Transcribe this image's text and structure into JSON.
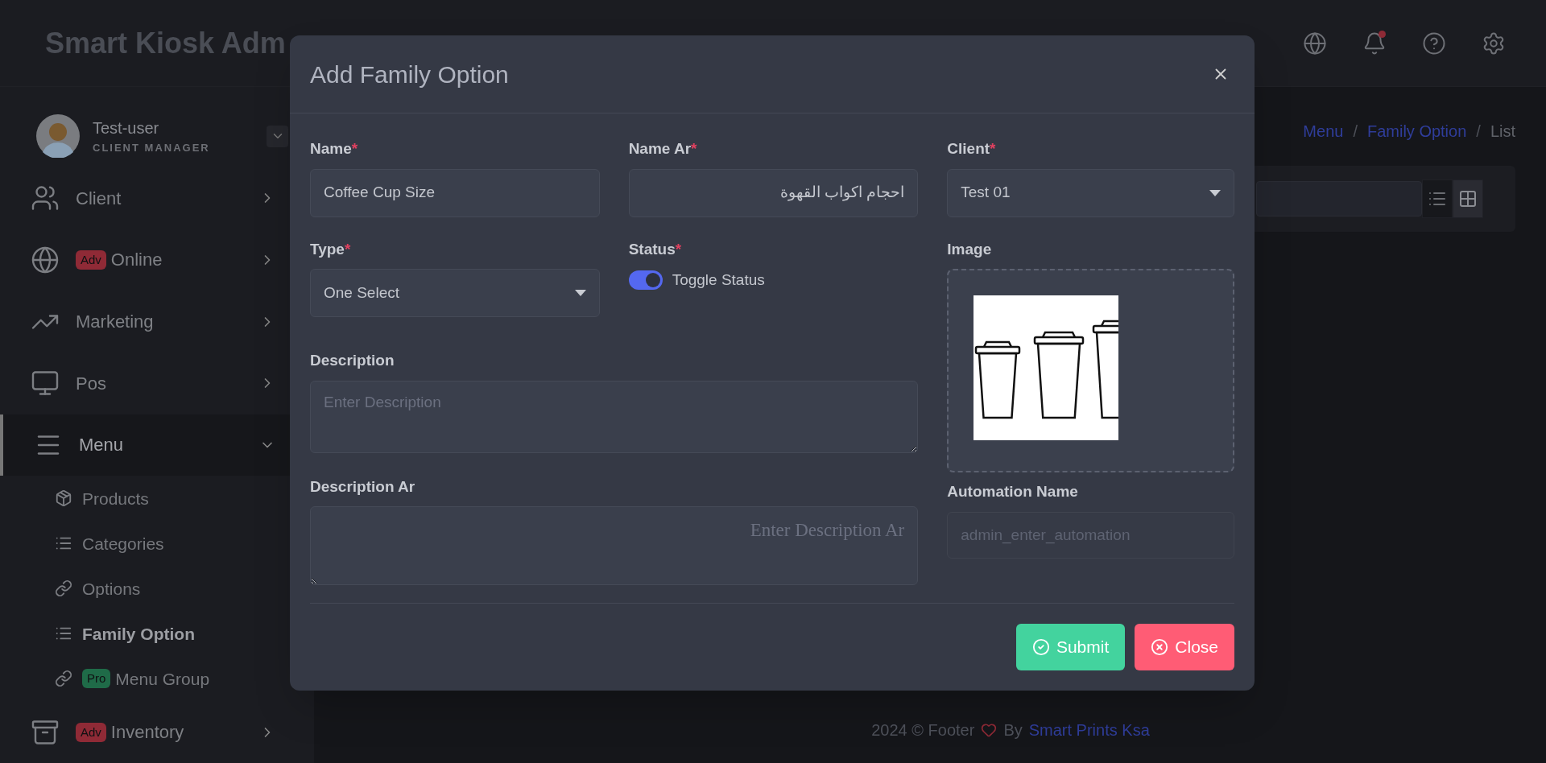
{
  "header": {
    "title": "Smart Kiosk Adm",
    "bell_dot": true
  },
  "user": {
    "name": "Test-user",
    "role": "CLIENT MANAGER"
  },
  "sidebar": {
    "items": [
      {
        "label": "Client",
        "selected": false,
        "expanded": false
      },
      {
        "label": "Online",
        "badge": {
          "text": "Adv",
          "color": "#8f2a36"
        },
        "selected": false,
        "expanded": false
      },
      {
        "label": "Marketing",
        "selected": false,
        "expanded": false
      },
      {
        "label": "Pos",
        "selected": false,
        "expanded": false
      },
      {
        "label": "Menu",
        "selected": true,
        "expanded": true,
        "children": [
          {
            "label": "Products",
            "selected": false
          },
          {
            "label": "Categories",
            "selected": false
          },
          {
            "label": "Options",
            "selected": false
          },
          {
            "label": "Family Option",
            "selected": true
          },
          {
            "label": "Menu Group",
            "badge": {
              "text": "Pro",
              "color": "#1f6b48"
            },
            "selected": false
          }
        ]
      },
      {
        "label": "Inventory",
        "badge": {
          "text": "Adv",
          "color": "#8f2a36"
        },
        "selected": false,
        "expanded": false
      }
    ]
  },
  "breadcrumb": [
    {
      "label": "Menu",
      "current": false
    },
    {
      "label": "Family Option",
      "current": false
    },
    {
      "label": "List",
      "current": true
    }
  ],
  "breadcrumb_separator": "/",
  "view_toggle": [
    {
      "selected": false
    },
    {
      "selected": true
    }
  ],
  "modal": {
    "title": "Add Family Option",
    "name": {
      "label": "Name",
      "required": "*",
      "value": "Coffee Cup Size"
    },
    "name_ar": {
      "label": "Name Ar",
      "required": "*",
      "value": "احجام اكواب القهوة"
    },
    "client": {
      "label": "Client",
      "required": "*",
      "value": "Test 01"
    },
    "type": {
      "label": "Type",
      "required": "*",
      "value": "One Select"
    },
    "status": {
      "label": "Status",
      "required": "*",
      "on": true,
      "text": "Toggle Status"
    },
    "image": {
      "label": "Image",
      "kind": "picture"
    },
    "description": {
      "label": "Description",
      "placeholder": "Enter Description"
    },
    "description_ar": {
      "label": "Description Ar",
      "placeholder": "Enter Description Ar"
    },
    "automation_name": {
      "label": "Automation Name",
      "placeholder": "admin_enter_automation"
    },
    "buttons": [
      {
        "label": "Submit",
        "kind": "submit"
      },
      {
        "label": "Close",
        "kind": "close"
      }
    ]
  },
  "footer": {
    "text": "2024 © Footer",
    "by": "By",
    "link": "Smart Prints Ksa"
  }
}
